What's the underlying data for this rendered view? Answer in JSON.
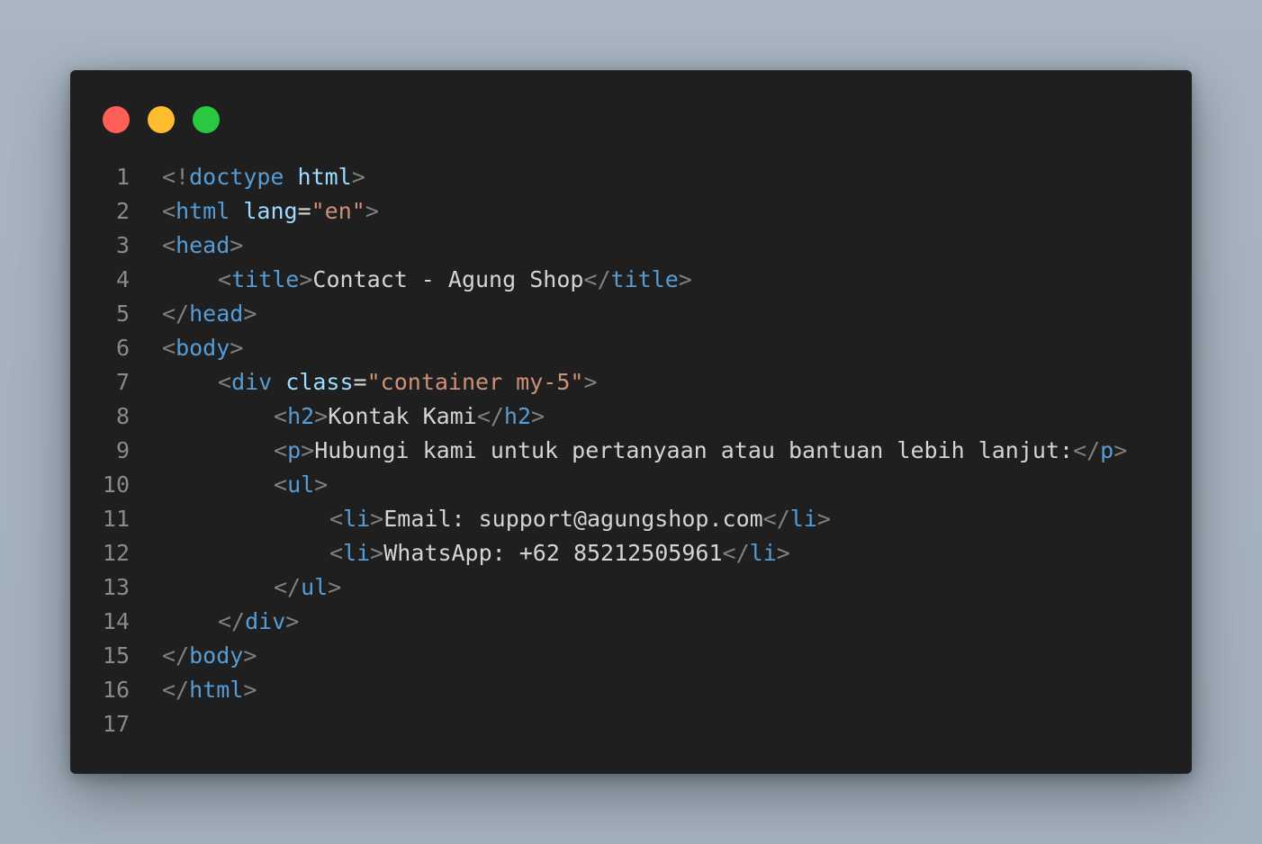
{
  "colors": {
    "close": "#ff5f57",
    "minimize": "#febc2e",
    "zoom": "#28c840",
    "punct": "#808080",
    "tag": "#569cd6",
    "attr": "#9cdcfe",
    "string": "#ce9178",
    "text": "#d4d4d4",
    "line_number": "#8a8a8a"
  },
  "lines": [
    {
      "n": "1",
      "indent": 0,
      "tokens": [
        {
          "t": "punct",
          "v": "<!"
        },
        {
          "t": "tag",
          "v": "doctype"
        },
        {
          "t": "text",
          "v": " "
        },
        {
          "t": "attr",
          "v": "html"
        },
        {
          "t": "punct",
          "v": ">"
        }
      ]
    },
    {
      "n": "2",
      "indent": 0,
      "tokens": [
        {
          "t": "punct",
          "v": "<"
        },
        {
          "t": "tag",
          "v": "html"
        },
        {
          "t": "text",
          "v": " "
        },
        {
          "t": "attr",
          "v": "lang"
        },
        {
          "t": "text",
          "v": "="
        },
        {
          "t": "string",
          "v": "\"en\""
        },
        {
          "t": "punct",
          "v": ">"
        }
      ]
    },
    {
      "n": "3",
      "indent": 0,
      "tokens": [
        {
          "t": "punct",
          "v": "<"
        },
        {
          "t": "tag",
          "v": "head"
        },
        {
          "t": "punct",
          "v": ">"
        }
      ]
    },
    {
      "n": "4",
      "indent": 1,
      "tokens": [
        {
          "t": "punct",
          "v": "<"
        },
        {
          "t": "tag",
          "v": "title"
        },
        {
          "t": "punct",
          "v": ">"
        },
        {
          "t": "text",
          "v": "Contact - Agung Shop"
        },
        {
          "t": "punct",
          "v": "</"
        },
        {
          "t": "tag",
          "v": "title"
        },
        {
          "t": "punct",
          "v": ">"
        }
      ]
    },
    {
      "n": "5",
      "indent": 0,
      "tokens": [
        {
          "t": "punct",
          "v": "</"
        },
        {
          "t": "tag",
          "v": "head"
        },
        {
          "t": "punct",
          "v": ">"
        }
      ]
    },
    {
      "n": "6",
      "indent": 0,
      "tokens": [
        {
          "t": "punct",
          "v": "<"
        },
        {
          "t": "tag",
          "v": "body"
        },
        {
          "t": "punct",
          "v": ">"
        }
      ]
    },
    {
      "n": "7",
      "indent": 1,
      "tokens": [
        {
          "t": "punct",
          "v": "<"
        },
        {
          "t": "tag",
          "v": "div"
        },
        {
          "t": "text",
          "v": " "
        },
        {
          "t": "attr",
          "v": "class"
        },
        {
          "t": "text",
          "v": "="
        },
        {
          "t": "string",
          "v": "\"container my-5\""
        },
        {
          "t": "punct",
          "v": ">"
        }
      ]
    },
    {
      "n": "8",
      "indent": 2,
      "tokens": [
        {
          "t": "punct",
          "v": "<"
        },
        {
          "t": "tag",
          "v": "h2"
        },
        {
          "t": "punct",
          "v": ">"
        },
        {
          "t": "text",
          "v": "Kontak Kami"
        },
        {
          "t": "punct",
          "v": "</"
        },
        {
          "t": "tag",
          "v": "h2"
        },
        {
          "t": "punct",
          "v": ">"
        }
      ]
    },
    {
      "n": "9",
      "indent": 2,
      "tokens": [
        {
          "t": "punct",
          "v": "<"
        },
        {
          "t": "tag",
          "v": "p"
        },
        {
          "t": "punct",
          "v": ">"
        },
        {
          "t": "text",
          "v": "Hubungi kami untuk pertanyaan atau bantuan lebih lanjut:"
        },
        {
          "t": "punct",
          "v": "</"
        },
        {
          "t": "tag",
          "v": "p"
        },
        {
          "t": "punct",
          "v": ">"
        }
      ]
    },
    {
      "n": "10",
      "indent": 2,
      "tokens": [
        {
          "t": "punct",
          "v": "<"
        },
        {
          "t": "tag",
          "v": "ul"
        },
        {
          "t": "punct",
          "v": ">"
        }
      ]
    },
    {
      "n": "11",
      "indent": 3,
      "tokens": [
        {
          "t": "punct",
          "v": "<"
        },
        {
          "t": "tag",
          "v": "li"
        },
        {
          "t": "punct",
          "v": ">"
        },
        {
          "t": "text",
          "v": "Email: support@agungshop.com"
        },
        {
          "t": "punct",
          "v": "</"
        },
        {
          "t": "tag",
          "v": "li"
        },
        {
          "t": "punct",
          "v": ">"
        }
      ]
    },
    {
      "n": "12",
      "indent": 3,
      "tokens": [
        {
          "t": "punct",
          "v": "<"
        },
        {
          "t": "tag",
          "v": "li"
        },
        {
          "t": "punct",
          "v": ">"
        },
        {
          "t": "text",
          "v": "WhatsApp: +62 85212505961"
        },
        {
          "t": "punct",
          "v": "</"
        },
        {
          "t": "tag",
          "v": "li"
        },
        {
          "t": "punct",
          "v": ">"
        }
      ]
    },
    {
      "n": "13",
      "indent": 2,
      "tokens": [
        {
          "t": "punct",
          "v": "</"
        },
        {
          "t": "tag",
          "v": "ul"
        },
        {
          "t": "punct",
          "v": ">"
        }
      ]
    },
    {
      "n": "14",
      "indent": 1,
      "tokens": [
        {
          "t": "punct",
          "v": "</"
        },
        {
          "t": "tag",
          "v": "div"
        },
        {
          "t": "punct",
          "v": ">"
        }
      ]
    },
    {
      "n": "15",
      "indent": 0,
      "tokens": [
        {
          "t": "punct",
          "v": "</"
        },
        {
          "t": "tag",
          "v": "body"
        },
        {
          "t": "punct",
          "v": ">"
        }
      ]
    },
    {
      "n": "16",
      "indent": 0,
      "tokens": [
        {
          "t": "punct",
          "v": "</"
        },
        {
          "t": "tag",
          "v": "html"
        },
        {
          "t": "punct",
          "v": ">"
        }
      ]
    },
    {
      "n": "17",
      "indent": 0,
      "tokens": []
    }
  ]
}
